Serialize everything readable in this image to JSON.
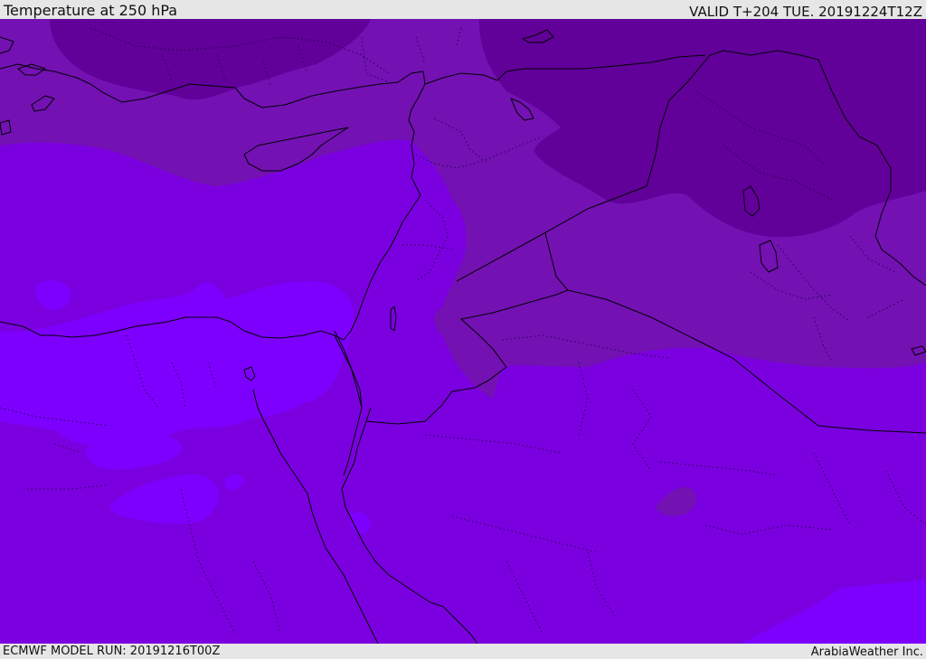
{
  "header": {
    "title": "Temperature at 250 hPa",
    "valid": "VALID T+204 TUE. 20191224T12Z"
  },
  "footer": {
    "model_run": "ECMWF MODEL RUN: 20191216T00Z",
    "credit": "ArabiaWeather Inc."
  },
  "map": {
    "field": "Temperature at 250 hPa",
    "region": "Eastern Mediterranean / Middle East",
    "legend_shown": false,
    "colors": {
      "coldest": "#62009a",
      "cold": "#7311b3",
      "mid": "#7b00e0",
      "warm": "#7d00ff",
      "land_borders": "#000000"
    }
  }
}
